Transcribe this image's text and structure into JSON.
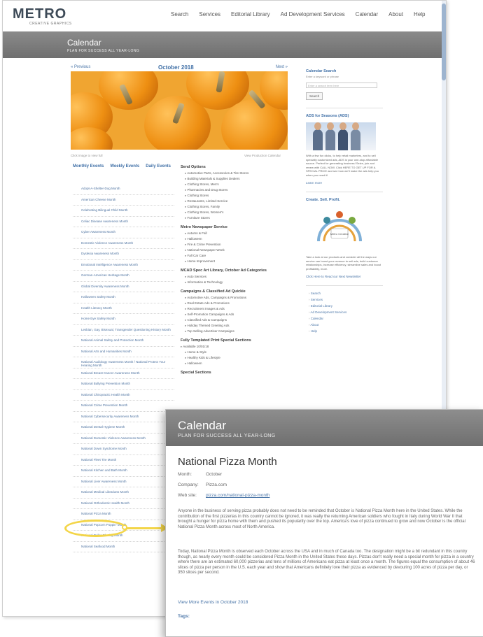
{
  "header": {
    "logo": "METRO",
    "tagline": "CREATIVE GRAPHICS",
    "nav": [
      "Search",
      "Services",
      "Editorial Library",
      "Ad Development Services",
      "Calendar",
      "About",
      "Help"
    ]
  },
  "banner": {
    "title": "Calendar",
    "subtitle": "PLAN FOR SUCCESS ALL YEAR-LONG"
  },
  "calendar": {
    "prev": "« Previous",
    "month": "October 2018",
    "next": "Next »",
    "image_caption_left": "Click image to view full",
    "image_caption_right": "View Production Calendar",
    "view_tabs": [
      "Monthly Events",
      "Weekly Events",
      "Daily Events"
    ]
  },
  "events": [
    "Adopt-A-Shelter-Dog Month",
    "American Cheese Month",
    "Celebrating Bilingual Child Month",
    "Celiac Disease Awareness Month",
    "Cyber Awareness Month",
    "Domestic Violence Awareness Month",
    "Dyslexia Awareness Month",
    "Emotional Intelligence Awareness Month",
    "German-American Heritage Month",
    "Global Diversity Awareness Month",
    "Halloween Safety Month",
    "Health Literacy Month",
    "Home Eye Safety Month",
    "Lesbian, Gay, Bisexual, Transgender Questioning History Month",
    "National Animal Safety and Protection Month",
    "National Arts and Humanities Month",
    "National Audiology Awareness Month / National Protect Your Hearing Month",
    "National Breast Cancer Awareness Month",
    "National Bullying Prevention Month",
    "National Chiropractic Health Month",
    "National Crime Prevention Month",
    "National Cybersecurity Awareness Month",
    "National Dental Hygiene Month",
    "National Domestic Violence Awareness Month",
    "National Down Syndrome Month",
    "National Fleet Tire Month",
    "National Kitchen and Bath Month",
    "National Liver Awareness Month",
    "National Medical Librarians Month",
    "National Orthodontic Health Month",
    "National Pizza Month",
    "National Popcorn Poppin' Month",
    "National Roller Skating Month",
    "National Seafood Month"
  ],
  "middle": {
    "sections": [
      {
        "heading": "Send Options",
        "items": [
          "Automotive Parts, Accessories & Tire Stores",
          "Building Materials & Supplies Dealers",
          "Clothing Stores, Men's",
          "Pharmacies and Drug Stores",
          "Clothing Stores",
          "Restaurants, Limited-Service",
          "Clothing Stores, Family",
          "Clothing Stores, Women's",
          "Furniture Stores"
        ]
      },
      {
        "heading": "Metro Newspaper Service",
        "items": [
          "Autumn & Fall",
          "Halloween",
          "Fire & Crime Prevention",
          "National Newspaper Week",
          "Fall Car Care",
          "Home Improvement"
        ]
      },
      {
        "heading": "MCAD Spec Art Library, October Ad Categories",
        "items": [
          "Auto Services",
          "Information & Technology"
        ]
      },
      {
        "heading": "Campaigns & Classified Ad Quickie",
        "items": [
          "Automotive Ads, Campaigns & Promotions",
          "Real Estate Ads & Promotions",
          "Recruitment Images & Ads",
          "Self-Promotion Campaigns & Ads",
          "Classified Ads & Campaigns",
          "Holiday Themed Greeting Ads",
          "Top Selling Advertiser Campaigns"
        ]
      },
      {
        "heading": "Fully Templated Print Special Sections",
        "sub": "Available 10/01/18",
        "items": [
          "Home & Style",
          "Healthy Kids & Lifestyle",
          "Halloween"
        ]
      },
      {
        "heading": "Special Sections",
        "items": []
      }
    ]
  },
  "sidebar": {
    "search_title": "Calendar Search",
    "search_subtitle": "Enter a keyword or phrase",
    "search_placeholder": "Enter a search term here",
    "search_button": "Search",
    "ads_title": "ADS for Seasons (ADS)",
    "ads_text": "With a few fun clicks, to help retail marketers, and to sell specialty customized ads, ADS is your one-stop affordable source. Perfect for generating business! Seize, join and renew with CALL NOW. Click HERE TO GET UP FOR A SPECIAL PRICE and see how we'll make the ads help you when you need it!",
    "ads_link": "Learn more",
    "cycle_title": "Create. Sell. Profit.",
    "cycle_center": "Metro Creative",
    "cycle_text": "Take a look at our products and consider all the ways our service can boost your revenue to sell ads, build customer relationships, increase efficiency, streamline sales and boost profitability, more.",
    "cycle_link": "Click Here to Read our Next Newsletter",
    "nav": [
      "Search",
      "Services",
      "Editorial Library",
      "Ad Development Services",
      "Calendar",
      "About",
      "Help"
    ]
  },
  "popup": {
    "banner_title": "Calendar",
    "banner_subtitle": "PLAN FOR SUCCESS ALL YEAR-LONG",
    "title": "National Pizza Month",
    "month_label": "Month:",
    "month_value": "October",
    "company_label": "Company:",
    "company_value": "Pizza.com",
    "website_label": "Web site:",
    "website_value": "pizza.com/national-pizza-month",
    "paragraph1": "Anyone in the business of serving pizza probably does not need to be reminded that October is National Pizza Month here in the United States. While the contribution of the first pizzerias in this country cannot be ignored, it was really the returning American soldiers who fought in Italy during World War II that brought a hunger for pizza home with them and pushed its popularity over the top. America's love of pizza continued to grow and now October is the official National Pizza Month across most of North America.",
    "paragraph2": "Today, National Pizza Month is observed each October across the USA and in much of Canada too. The designation might be a bit redundant in this country though, as nearly every month could be considered Pizza Month in the United States these days. Pizzas don't really need a special month for pizza in a country where there are an estimated 60,000 pizzerias and tens of millions of Americans eat pizza at least once a month. The figures equal the consumption of about 46 slices of pizza per person in the U.S. each year and show that Americans definitely love their pizza as evidenced by devouring 100 acres of pizza per day, or 350 slices per second.",
    "more_link": "View More Events in October 2018",
    "tags_label": "Tags:"
  }
}
